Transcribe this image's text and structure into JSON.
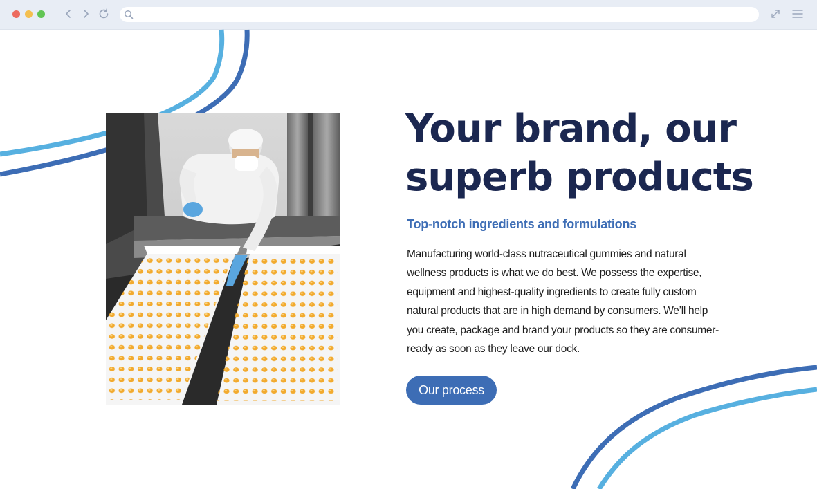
{
  "browser": {
    "url_value": "",
    "icons": {
      "back": "chevron-left-icon",
      "forward": "chevron-right-icon",
      "reload": "reload-icon",
      "search": "search-icon",
      "expand": "expand-icon",
      "menu": "hamburger-menu-icon"
    },
    "window_buttons": [
      "close",
      "minimize",
      "zoom"
    ]
  },
  "hero": {
    "image_alt": "Worker in white protective suit, hairnet, mask and blue gloves arranging trays of orange gummies on a production line",
    "headline": "Your brand, our superb products",
    "subheadline": "Top-notch ingredients and formulations",
    "body": "Manufacturing world-class nutraceutical gummies and natural wellness products is what we do best. We possess the expertise, equipment and highest-quality ingredients to create fully custom natural products that are in high demand by consumers. We’ll help you create, package and brand your products so they are consumer-ready as soon as they leave our dock.",
    "cta_label": "Our process"
  },
  "colors": {
    "headline": "#1b2750",
    "accent_blue": "#3d6db5",
    "light_blue": "#57b0e0",
    "chrome_bg": "#e8edf5"
  }
}
